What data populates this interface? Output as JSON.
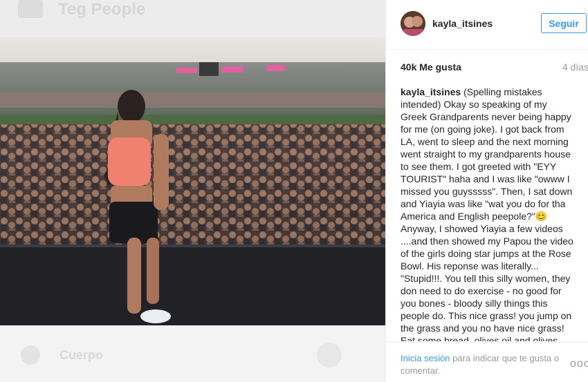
{
  "background": {
    "title": "Teg People",
    "bottom_label": "Cuerpo"
  },
  "post": {
    "username": "kayla_itsines",
    "follow_label": "Seguir",
    "likes": "40k Me gusta",
    "time": "4 días",
    "caption": "(Spelling mistakes intended) Okay so speaking of my Greek Grandparents never being happy for me (on going joke). I got back from LA, went to sleep and the next morning went straight to my grandparents house to see them. I got greeted with \"EYY TOURIST\" haha and I was like \"owww I missed you guysssss\". Then, I sat down and Yiayia was like \"wat you do for tha America and English peepole?\"😊Anyway, I showed Yiayia a few videos ....and then showed my Papou the video of the girls doing star jumps at the Rose Bowl. His reponse was literally... \"Stupid!!!. You tell this silly women, they don need to do exercise - no good for you bones - bloody silly things this people do. This nice grass! you jump on the grass and you no have nice grass! Eat some bread, olives oil and olives and you be healthy - like me. I no have do exercise. I'm walking and I'm",
    "footer_login": "Inicia sesión",
    "footer_rest": " para indicar que te gusta o comentar.",
    "more_label": "ooo"
  },
  "colors": {
    "accent": "#3897f0",
    "text": "#262626",
    "muted": "#999999"
  }
}
